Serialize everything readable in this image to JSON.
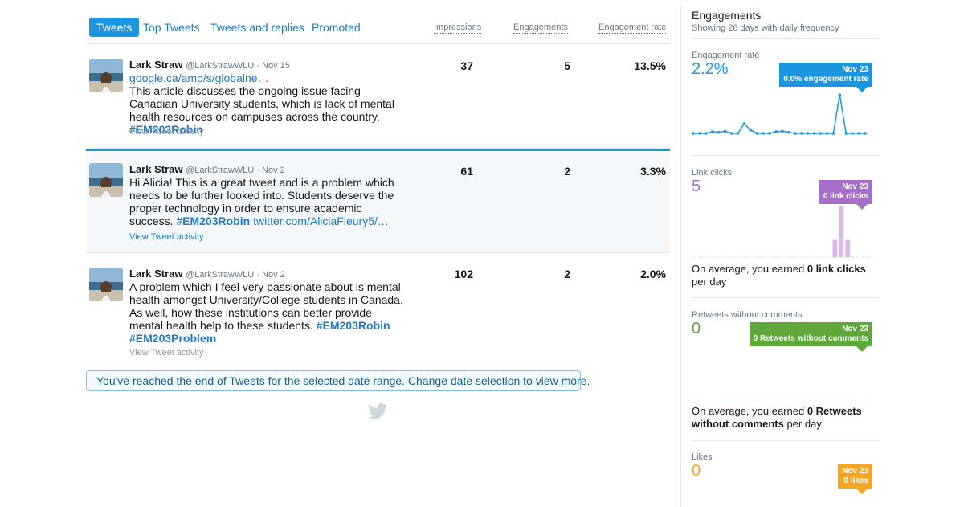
{
  "tabs": [
    {
      "label": "Tweets",
      "active": true
    },
    {
      "label": "Top Tweets",
      "active": false
    },
    {
      "label": "Tweets and replies",
      "active": false
    },
    {
      "label": "Promoted",
      "active": false
    }
  ],
  "columns": {
    "impressions": "Impressions",
    "engagements": "Engagements",
    "engagement_rate": "Engagement rate"
  },
  "tweets": [
    {
      "name": "Lark Straw",
      "meta": "@LarkStrawWLU · Nov 15",
      "link_top": "google.ca/amp/s/globalne…",
      "text": "This article discusses the ongoing issue facing Canadian University students, which is lack of mental health resources on campuses across the country.",
      "hashtag": "#EM203Robin",
      "activity": "View Tweet activity",
      "impressions": "37",
      "engagements": "5",
      "rate": "13.5%"
    },
    {
      "name": "Lark Straw",
      "meta": "@LarkStrawWLU · Nov 2",
      "text": "Hi Alicia! This is a great tweet and is a problem which needs to be further looked into. Students deserve the proper technology in order to ensure academic success.",
      "hashtag": "#EM203Robin",
      "link_bottom": "twitter.com/AliciaFleury5/…",
      "activity": "View Tweet activity",
      "impressions": "61",
      "engagements": "2",
      "rate": "3.3%"
    },
    {
      "name": "Lark Straw",
      "meta": "@LarkStrawWLU · Nov 2",
      "text": "A problem which I feel very passionate about is mental health amongst University/College students in Canada. As well, how these institutions can better provide mental health help to these students.",
      "hashtag": "#EM203Robin",
      "hashtag2": "#EM203Problem",
      "activity": "View Tweet activity",
      "impressions": "102",
      "engagements": "2",
      "rate": "2.0%"
    }
  ],
  "end_banner": "You've reached the end of Tweets for the selected date range. Change date selection to view more.",
  "panel": {
    "title": "Engagements",
    "subtitle": "Showing 28 days with daily frequency",
    "engagement_rate": {
      "label": "Engagement rate",
      "value": "2.2%",
      "tip_date": "Nov 23",
      "tip_text": "0.0% engagement rate",
      "color": "#1b95e0"
    },
    "link_clicks": {
      "label": "Link clicks",
      "value": "5",
      "tip_date": "Nov 23",
      "tip_text": "0 link clicks",
      "color": "#a66ec8",
      "avg_prefix": "On average, you earned ",
      "avg_bold": "0 link clicks",
      "avg_suffix": " per day"
    },
    "retweets": {
      "label": "Retweets without comments",
      "value": "0",
      "tip_date": "Nov 23",
      "tip_text": "0 Retweets without comments",
      "color": "#5ea73a",
      "avg_prefix": "On average, you earned ",
      "avg_bold": "0 Retweets without comments",
      "avg_suffix": " per day"
    },
    "likes": {
      "label": "Likes",
      "value": "0",
      "tip_date": "Nov 23",
      "tip_text": "0 likes",
      "color": "#f5a623"
    }
  },
  "chart_data": [
    {
      "type": "line",
      "title": "Engagement rate",
      "x": [
        1,
        2,
        3,
        4,
        5,
        6,
        7,
        8,
        9,
        10,
        11,
        12,
        13,
        14,
        15,
        16,
        17,
        18,
        19,
        20,
        21,
        22,
        23,
        24,
        25,
        26,
        27,
        28
      ],
      "values": [
        0,
        0,
        0,
        0.6,
        0.4,
        0.8,
        0,
        0,
        3.5,
        1.2,
        0,
        0,
        0,
        0.6,
        0.8,
        0.4,
        0,
        0,
        0,
        0,
        0,
        0,
        0,
        14.0,
        0,
        0,
        0,
        0
      ],
      "color": "#1b95e0"
    },
    {
      "type": "bar",
      "title": "Link clicks",
      "x": [
        1,
        2,
        3,
        4,
        5,
        6,
        7,
        8,
        9,
        10,
        11,
        12,
        13,
        14,
        15,
        16,
        17,
        18,
        19,
        20,
        21,
        22,
        23,
        24,
        25,
        26,
        27,
        28
      ],
      "values": [
        0,
        0,
        0,
        0,
        0,
        0,
        0,
        0,
        0,
        0,
        0,
        0,
        0,
        0,
        0,
        0,
        0,
        0,
        0,
        0,
        0,
        0,
        1,
        3,
        1,
        0,
        0,
        0
      ],
      "color": "#a66ec8"
    }
  ]
}
